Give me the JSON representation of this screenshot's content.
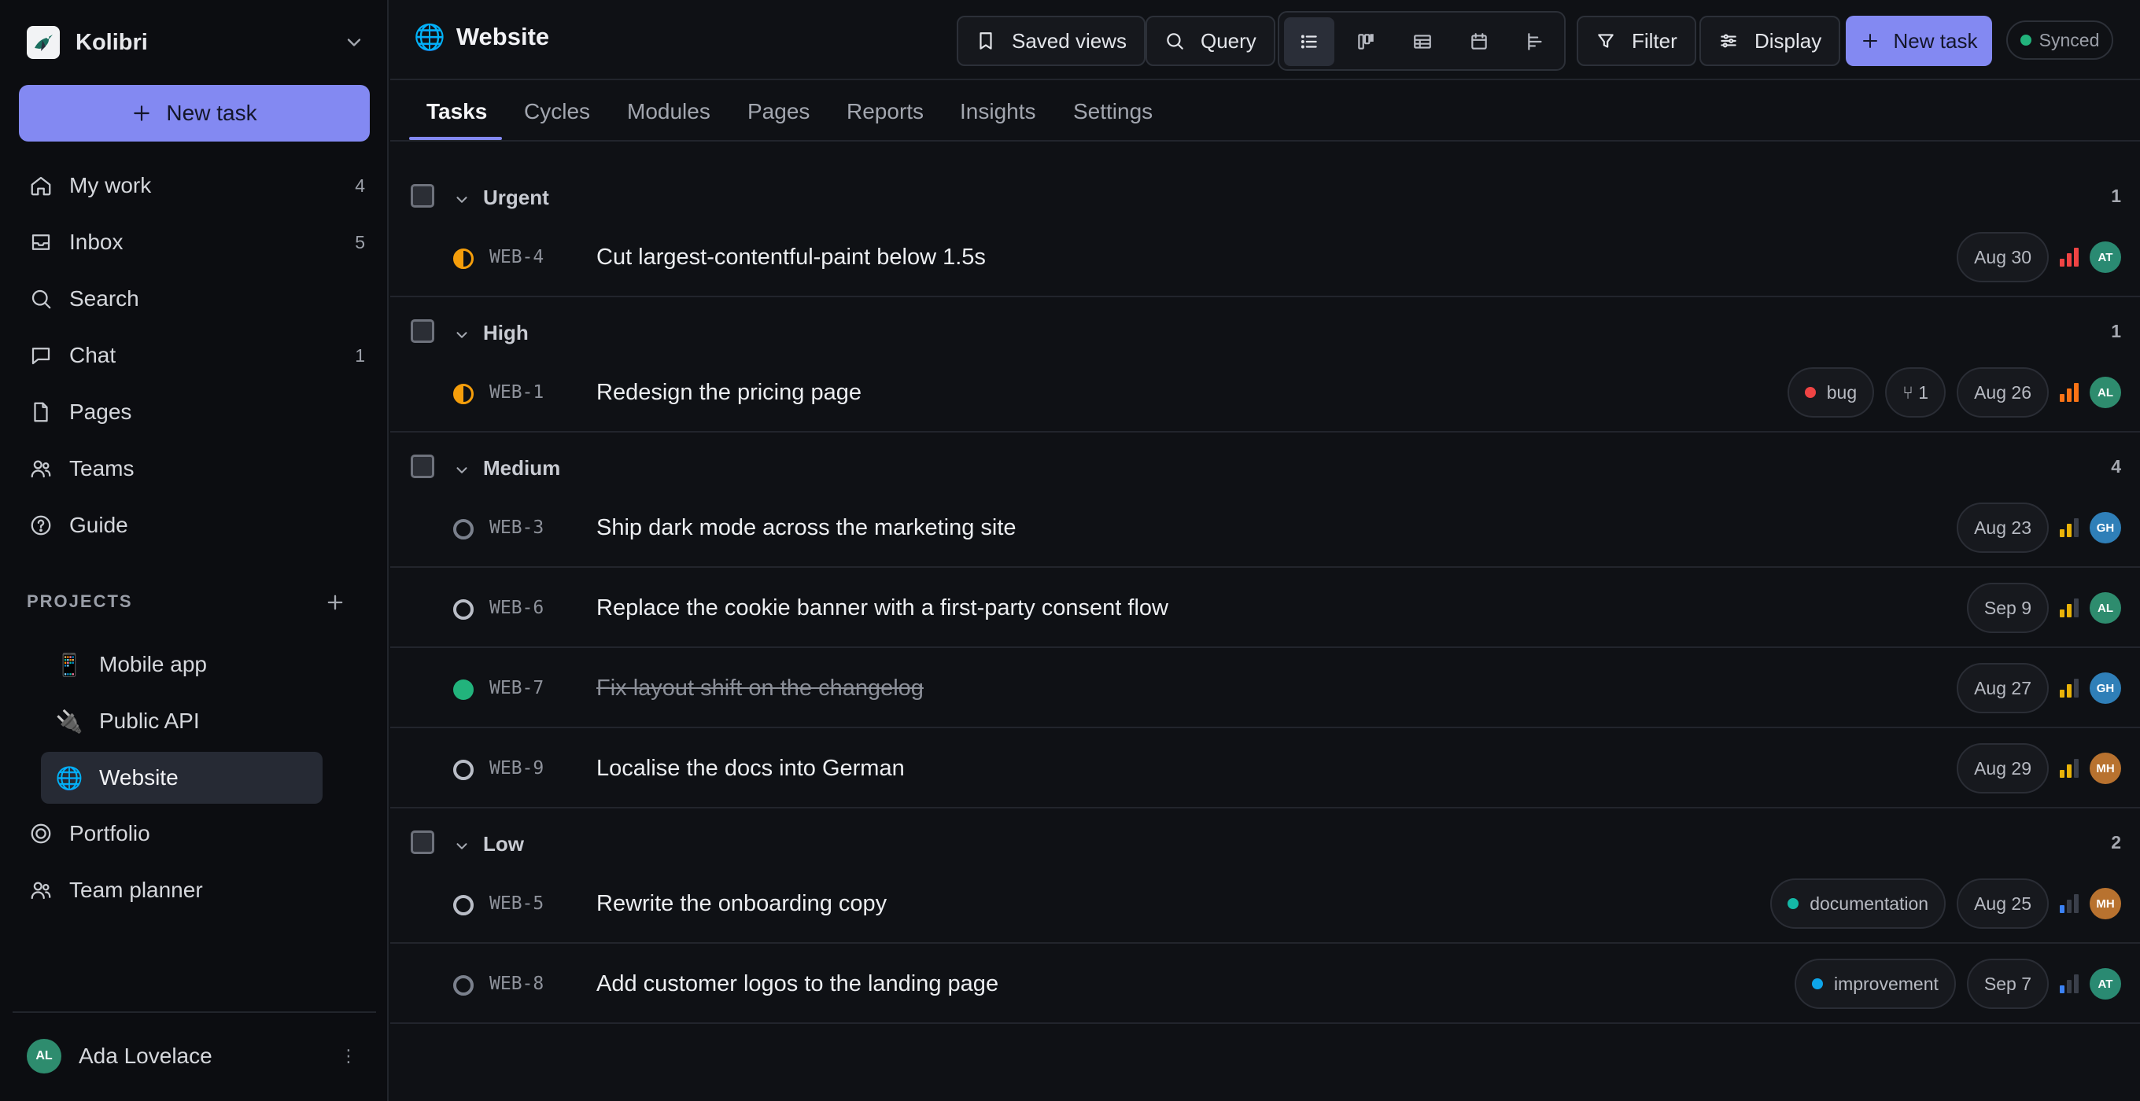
{
  "workspace": {
    "name": "Kolibri"
  },
  "sidebar": {
    "new_task_label": "New task",
    "nav": [
      {
        "label": "My work",
        "count": "4",
        "icon": "home-icon"
      },
      {
        "label": "Inbox",
        "count": "5",
        "icon": "inbox-icon"
      },
      {
        "label": "Search",
        "count": "",
        "icon": "search-icon"
      },
      {
        "label": "Chat",
        "count": "1",
        "icon": "chat-icon"
      },
      {
        "label": "Pages",
        "count": "",
        "icon": "page-icon"
      },
      {
        "label": "Teams",
        "count": "",
        "icon": "users-icon"
      },
      {
        "label": "Guide",
        "count": "",
        "icon": "help-icon"
      }
    ],
    "projects_title": "PROJECTS",
    "projects": [
      {
        "label": "Mobile app",
        "emoji": "📱"
      },
      {
        "label": "Public API",
        "emoji": "🔌"
      },
      {
        "label": "Website",
        "emoji": "🌐",
        "active": true
      }
    ],
    "extra": [
      {
        "label": "Portfolio",
        "icon": "target-icon"
      },
      {
        "label": "Team planner",
        "icon": "users-icon"
      }
    ],
    "user": {
      "name": "Ada Lovelace",
      "initials": "AL",
      "menu_glyph": "⋮"
    }
  },
  "header": {
    "title": "Website",
    "title_emoji": "🌐",
    "saved_views": "Saved views",
    "query": "Query",
    "views": [
      "list-view-icon",
      "board-view-icon",
      "table-view-icon",
      "calendar-view-icon",
      "timeline-view-icon"
    ],
    "filter": "Filter",
    "display": "Display",
    "new_task": "New task",
    "sync_status": "Synced"
  },
  "tabs": [
    "Tasks",
    "Cycles",
    "Modules",
    "Pages",
    "Reports",
    "Insights",
    "Settings"
  ],
  "colors": {
    "accent": "#8389f2",
    "status_in_progress": "#f59e0b",
    "status_done": "#22b37c",
    "status_todo": "#6b7280",
    "prio_urgent": "#ef4444",
    "prio_high": "#f97316",
    "prio_medium": "#eab308",
    "prio_low": "#3b82f6",
    "label_bug": "#ef4444",
    "label_documentation": "#14b8a6",
    "label_improvement": "#0ea5e9"
  },
  "groups": [
    {
      "label": "Urgent",
      "count": "1",
      "tasks": [
        {
          "id": "WEB-4",
          "title": "Cut largest-contentful-paint below 1.5s",
          "status": "in-progress",
          "labels": [],
          "subtasks": "",
          "due": "Aug 30",
          "priority": "urgent",
          "assignee": "AT",
          "assignee_color": "#2a8a72"
        }
      ]
    },
    {
      "label": "High",
      "count": "1",
      "tasks": [
        {
          "id": "WEB-1",
          "title": "Redesign the pricing page",
          "status": "in-progress",
          "labels": [
            {
              "name": "bug",
              "color": "#ef4444"
            }
          ],
          "subtasks": "⑂ 1",
          "due": "Aug 26",
          "priority": "high",
          "assignee": "AL",
          "assignee_color": "#2e8c6e"
        }
      ]
    },
    {
      "label": "Medium",
      "count": "4",
      "tasks": [
        {
          "id": "WEB-3",
          "title": "Ship dark mode across the marketing site",
          "status": "todo",
          "labels": [],
          "subtasks": "",
          "due": "Aug 23",
          "priority": "medium",
          "assignee": "GH",
          "assignee_color": "#2f7fb8"
        },
        {
          "id": "WEB-6",
          "title": "Replace the cookie banner with a first-party consent flow",
          "status": "todo-light",
          "labels": [],
          "subtasks": "",
          "due": "Sep 9",
          "priority": "medium",
          "assignee": "AL",
          "assignee_color": "#2e8c6e"
        },
        {
          "id": "WEB-7",
          "title": "Fix layout shift on the changelog",
          "status": "done",
          "labels": [],
          "subtasks": "",
          "due": "Aug 27",
          "priority": "medium",
          "assignee": "GH",
          "assignee_color": "#2f7fb8"
        },
        {
          "id": "WEB-9",
          "title": "Localise the docs into German",
          "status": "todo-light",
          "labels": [],
          "subtasks": "",
          "due": "Aug 29",
          "priority": "medium",
          "assignee": "MH",
          "assignee_color": "#b8722f"
        }
      ]
    },
    {
      "label": "Low",
      "count": "2",
      "tasks": [
        {
          "id": "WEB-5",
          "title": "Rewrite the onboarding copy",
          "status": "todo-light",
          "labels": [
            {
              "name": "documentation",
              "color": "#14b8a6"
            }
          ],
          "subtasks": "",
          "due": "Aug 25",
          "priority": "low",
          "assignee": "MH",
          "assignee_color": "#b8722f"
        },
        {
          "id": "WEB-8",
          "title": "Add customer logos to the landing page",
          "status": "todo",
          "labels": [
            {
              "name": "improvement",
              "color": "#0ea5e9"
            }
          ],
          "subtasks": "",
          "due": "Sep 7",
          "priority": "low",
          "assignee": "AT",
          "assignee_color": "#2a8a72"
        }
      ]
    }
  ]
}
